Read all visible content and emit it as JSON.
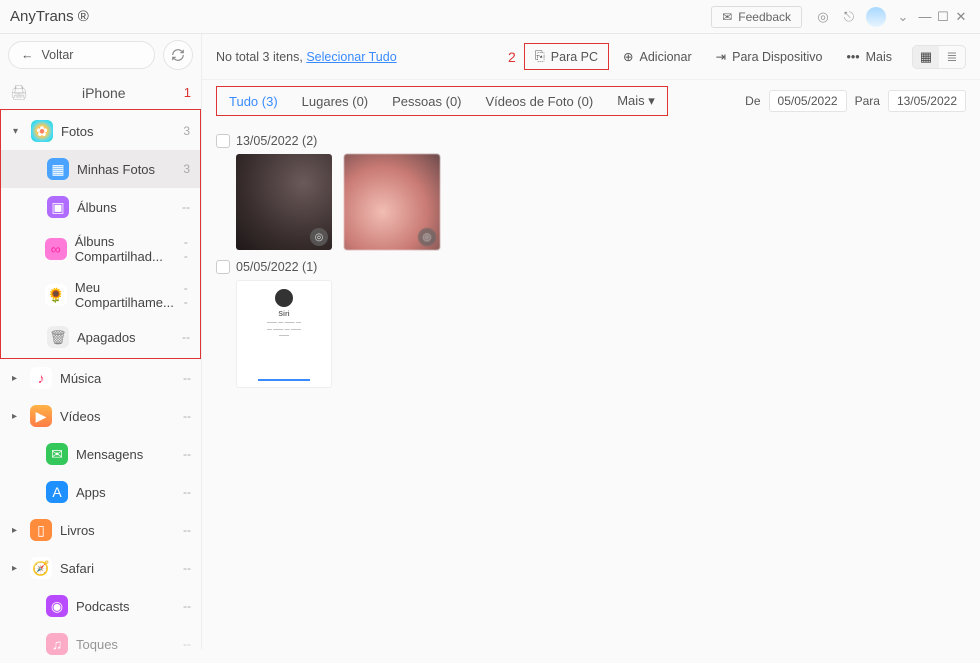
{
  "title": "AnyTrans ®",
  "feedback_label": "Feedback",
  "back_label": "Voltar",
  "device_name": "iPhone",
  "annotation_1": "1",
  "annotation_2": "2",
  "sidebar": {
    "photos": {
      "label": "Fotos",
      "count": "3"
    },
    "my_photos": {
      "label": "Minhas Fotos",
      "count": "3"
    },
    "albums": {
      "label": "Álbuns",
      "count": "--"
    },
    "shared_albums": {
      "label": "Álbuns Compartilhad...",
      "count": "--"
    },
    "my_stream": {
      "label": "Meu Compartilhame...",
      "count": "--"
    },
    "trash": {
      "label": "Apagados",
      "count": "--"
    },
    "music": {
      "label": "Música",
      "count": "--"
    },
    "videos": {
      "label": "Vídeos",
      "count": "--"
    },
    "messages": {
      "label": "Mensagens",
      "count": "--"
    },
    "apps": {
      "label": "Apps",
      "count": "--"
    },
    "books": {
      "label": "Livros",
      "count": "--"
    },
    "safari": {
      "label": "Safari",
      "count": "--"
    },
    "podcasts": {
      "label": "Podcasts",
      "count": "--"
    },
    "tones": {
      "label": "Toques",
      "count": "--"
    }
  },
  "toolbar": {
    "total_prefix": "No total 3 itens, ",
    "select_all": "Selecionar Tudo",
    "to_pc": "Para PC",
    "add": "Adicionar",
    "to_device": "Para Dispositivo",
    "more": "Mais"
  },
  "filters": {
    "all": "Tudo (3)",
    "places": "Lugares (0)",
    "people": "Pessoas (0)",
    "photo_videos": "Vídeos de Foto (0)",
    "more": "Mais ▾"
  },
  "dates": {
    "from_label": "De",
    "from_value": "05/05/2022",
    "to_label": "Para",
    "to_value": "13/05/2022"
  },
  "groups": [
    {
      "label": "13/05/2022 (2)"
    },
    {
      "label": "05/05/2022 (1)"
    }
  ],
  "siri_label": "Siri"
}
